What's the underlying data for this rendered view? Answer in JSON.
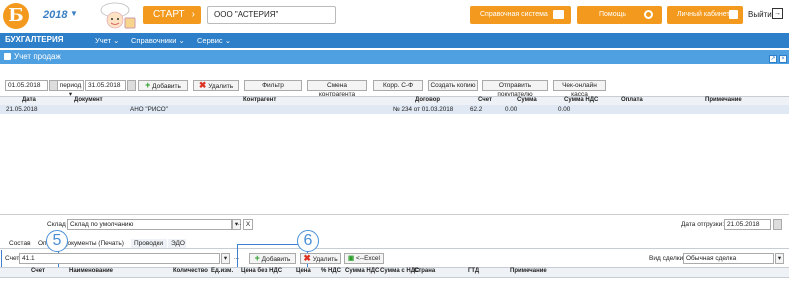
{
  "header": {
    "year": "2018",
    "start_label": "СТАРТ",
    "organization": "ООО \"АСТЕРИЯ\"",
    "help_system_label": "Справочная система",
    "help_label": "Помощь",
    "cabinet_label": "Личный кабинет",
    "exit_label": "Выйти"
  },
  "nav": {
    "brand": "БУХГАЛТЕРИЯ",
    "items": [
      "Учет",
      "Справочники",
      "Сервис"
    ]
  },
  "panel": {
    "title": "Учет продаж"
  },
  "toolbar": {
    "date_from": "01.05.2018",
    "period_label": "период",
    "date_to": "31.05.2018",
    "add_label": "Добавить",
    "delete_label": "Удалить",
    "filter_label": "Фильтр",
    "change_contractor_label": "Смена контрагента",
    "corr_label": "Корр. С-Ф",
    "copy_label": "Создать копию",
    "send_buyer_label": "Отправить покупателю",
    "online_check_label": "Чек-онлайн касса"
  },
  "table": {
    "columns": [
      "Дата",
      "Документ",
      "Контрагент",
      "Договор",
      "Счет",
      "Сумма",
      "Сумма НДС",
      "Оплата",
      "Примечание"
    ],
    "rows": [
      {
        "date": "21.05.2018",
        "document": "",
        "contractor": "АНО \"РИСО\"",
        "contract": "№ 234 от 01.03.2018",
        "account": "62.2",
        "sum": "0.00",
        "vat": "0.00",
        "payment": "",
        "note": ""
      }
    ]
  },
  "bottom": {
    "warehouse_label": "Склад",
    "warehouse_value": "Склад по умолчанию",
    "ship_date_label": "Дата отгрузки:",
    "ship_date_value": "21.05.2018",
    "tabs": [
      "Состав",
      "Оп",
      "Документы (Печать)",
      "Проводки",
      "ЭДО"
    ],
    "account_label": "Счет:",
    "account_value": "41.1",
    "add_label": "Добавить",
    "delete_label": "Удалить",
    "excel_label": "<--Excel",
    "deal_type_label": "Вид сделки:",
    "deal_type_value": "Обычная сделка",
    "columns": [
      "Счет",
      "Наименование",
      "Количество",
      "Ед.изм.",
      "Цена без НДС",
      "Цена",
      "% НДС",
      "Сумма НДС",
      "Сумма с НДС",
      "Страна",
      "ГТД",
      "Примечание"
    ]
  },
  "callouts": {
    "first": "5",
    "second": "6"
  },
  "colors": {
    "accent_orange": "#f39a1e",
    "nav_blue": "#2c7fc8",
    "panel_blue": "#4fa0e0"
  }
}
